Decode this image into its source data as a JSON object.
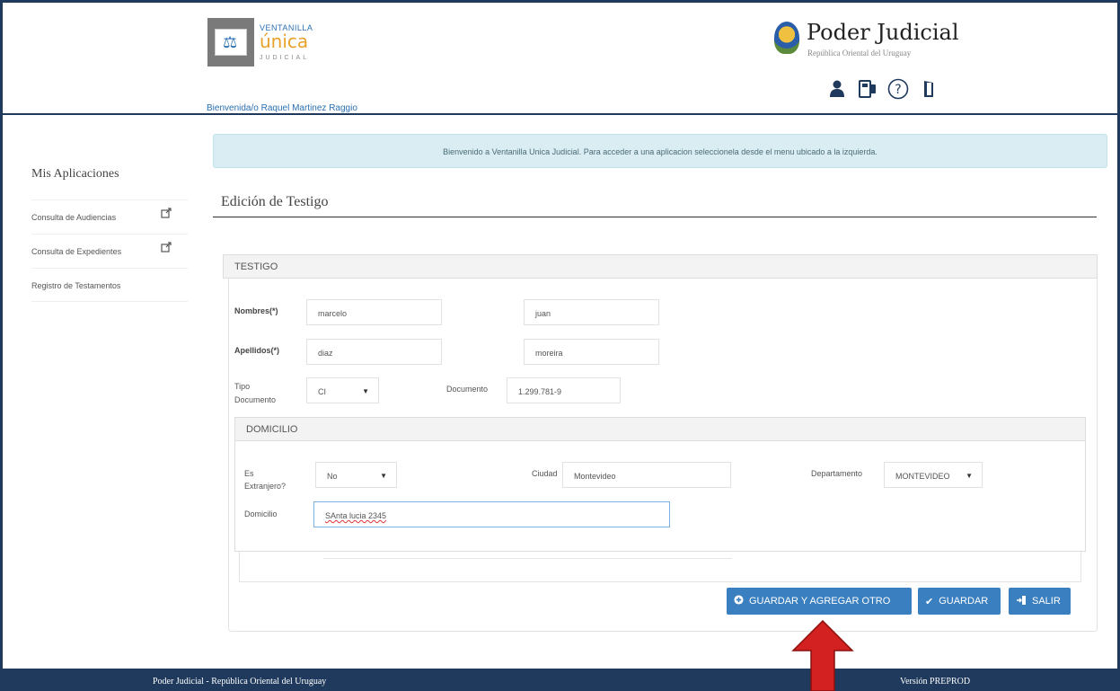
{
  "header": {
    "logo_line1": "VENTANILLA",
    "logo_line2": "única",
    "logo_line3": "JUDICIAL",
    "welcome_user": "Bienvenida/o Raquel Martinez Raggio",
    "org_title": "Poder Judicial",
    "org_subtitle": "República Oriental del Uruguay",
    "icons": [
      "user-icon",
      "phone-icon",
      "help-icon",
      "logout-icon"
    ]
  },
  "sidebar": {
    "title": "Mis Aplicaciones",
    "items": [
      {
        "label": "Consulta de Audiencias",
        "icon": "external-link-icon"
      },
      {
        "label": "Consulta de Expedientes",
        "icon": "external-link-icon"
      },
      {
        "label": "Registro de Testamentos"
      }
    ]
  },
  "alert": {
    "text": "Bienvenido a Ventanilla Unica Judicial. Para acceder a una aplicacion seleccionela desde el menu ubicado a la izquierda."
  },
  "page": {
    "title": "Edición de Testigo"
  },
  "testigo": {
    "section_title": "TESTIGO",
    "nombres_label": "Nombres(*)",
    "nombre1": "marcelo",
    "nombre2": "juan",
    "apellidos_label": "Apellidos(*)",
    "apellido1": "diaz",
    "apellido2": "moreira",
    "tipo_doc_label_1": "Tipo",
    "tipo_doc_label_2": "Documento",
    "tipo_doc_value": "CI",
    "documento_label": "Documento",
    "documento_value": "1.299.781-9"
  },
  "domicilio": {
    "section_title": "DOMICILIO",
    "extranjero_label_1": "Es",
    "extranjero_label_2": "Extranjero?",
    "extranjero_value": "No",
    "ciudad_label": "Ciudad",
    "ciudad_value": "Montevideo",
    "departamento_label": "Departamento",
    "departamento_value": "MONTEVIDEO",
    "domicilio_label": "Domicilio",
    "domicilio_value": "SAnta lucia 2345"
  },
  "actions": {
    "save_add": "GUARDAR Y AGREGAR OTRO",
    "save": "GUARDAR",
    "exit": "SALIR"
  },
  "footer": {
    "left": "Poder Judicial - República Oriental del Uruguay",
    "right": "Versión PREPROD"
  },
  "colors": {
    "primary": "#3a7fbf",
    "navy": "#1f3a5c",
    "alert_bg": "#d9edf2",
    "arrow": "#d32020"
  }
}
